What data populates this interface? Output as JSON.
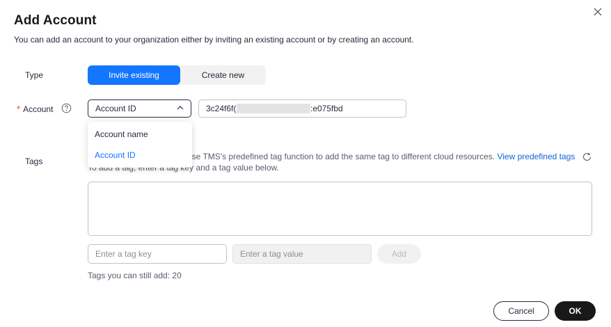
{
  "dialog": {
    "title": "Add Account",
    "subtitle": "You can add an account to your organization either by inviting an existing account or by creating an account."
  },
  "type_row": {
    "label": "Type",
    "options": [
      "Invite existing",
      "Create new"
    ],
    "selected": "Invite existing"
  },
  "account_row": {
    "label": "Account",
    "selected": "Account ID",
    "value_start": "3c24f6f(",
    "value_end": ":e075fbd",
    "dropdown_options": [
      "Account name",
      "Account ID"
    ]
  },
  "tags": {
    "label": "Tags",
    "desc_line1_prefix": "If you want to use the same tag to identify multiple cloud resources, use TMS's predefined tag function to add the same tag to different cloud resources. ",
    "desc_line1_visible": "use TMS's predefined tag function to add the same tag to different cloud resources.",
    "link": "View predefined tags",
    "desc_line2": "To add a tag, enter a tag key and a tag value below.",
    "key_placeholder": "Enter a tag key",
    "value_placeholder": "Enter a tag value",
    "add_label": "Add",
    "remaining": "Tags you can still add: 20"
  },
  "footer": {
    "cancel_label": "Cancel",
    "ok_label": "OK"
  },
  "colors": {
    "primary": "#1476ff",
    "ok_button": "#191919",
    "required": "#e54545",
    "link": "#0d63d6"
  }
}
